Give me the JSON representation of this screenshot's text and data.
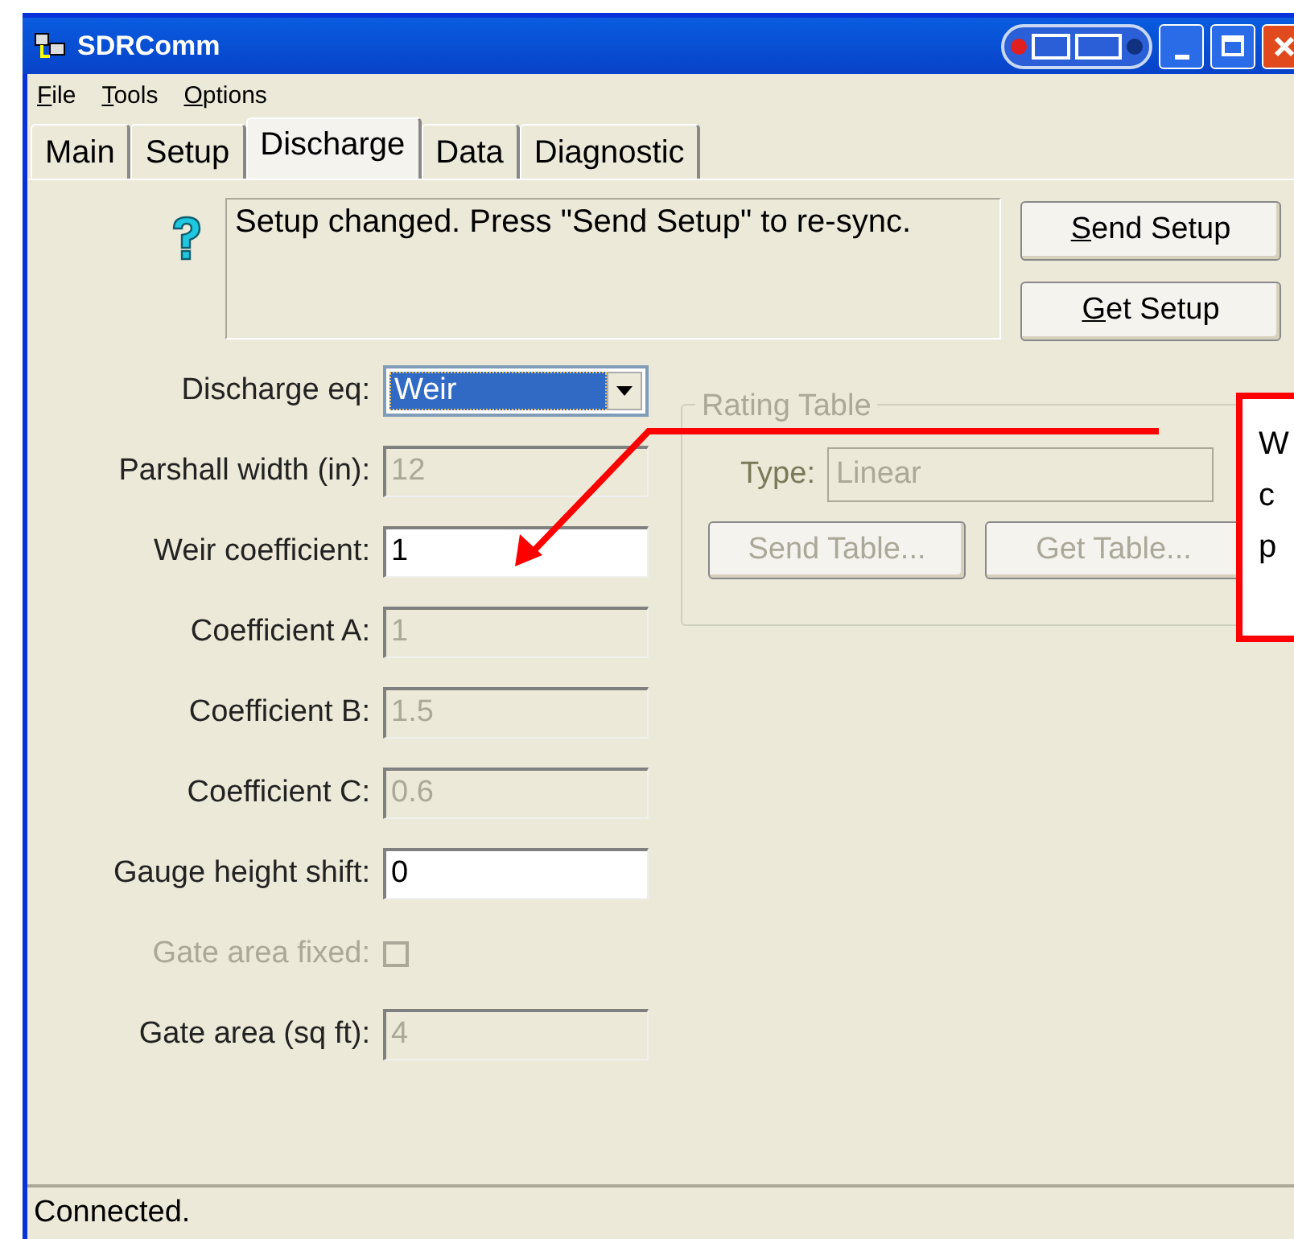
{
  "window": {
    "title": "SDRComm"
  },
  "menu": [
    {
      "label": "File"
    },
    {
      "label": "Tools"
    },
    {
      "label": "Options"
    }
  ],
  "tabs": [
    {
      "label": "Main",
      "selected": false
    },
    {
      "label": "Setup",
      "selected": false
    },
    {
      "label": "Discharge",
      "selected": true
    },
    {
      "label": "Data",
      "selected": false
    },
    {
      "label": "Diagnostic",
      "selected": false
    }
  ],
  "message": "Setup changed. Press \"Send Setup\" to re-sync.",
  "buttons": [
    {
      "label": "Send Setup"
    },
    {
      "label": "Get Setup"
    }
  ],
  "fields": [
    {
      "kind": "dropdown",
      "label": "Discharge eq:",
      "value": "Weir",
      "disabled": false
    },
    {
      "kind": "text",
      "label": "Parshall width (in):",
      "value": "12",
      "disabled": true
    },
    {
      "kind": "text",
      "label": "Weir coefficient:",
      "value": "1",
      "disabled": false
    },
    {
      "kind": "text",
      "label": "Coefficient A:",
      "value": "1",
      "disabled": true
    },
    {
      "kind": "text",
      "label": "Coefficient B:",
      "value": "1.5",
      "disabled": true
    },
    {
      "kind": "text",
      "label": "Coefficient C:",
      "value": "0.6",
      "disabled": true
    },
    {
      "kind": "text",
      "label": "Gauge height shift:",
      "value": "0",
      "disabled": false
    },
    {
      "kind": "checkbox",
      "label": "Gate area fixed:",
      "checked": false,
      "disabled": true
    },
    {
      "kind": "text",
      "label": "Gate area (sq ft):",
      "value": "4",
      "disabled": true
    }
  ],
  "rating_table": {
    "title": "Rating Table",
    "type_label": "Type:",
    "type_value": "Linear",
    "disabled": true,
    "buttons": [
      {
        "label": "Send Table..."
      },
      {
        "label": "Get Table..."
      }
    ]
  },
  "callout": {
    "lines": [
      "W",
      "c",
      "p"
    ]
  },
  "status_bar": "Connected."
}
